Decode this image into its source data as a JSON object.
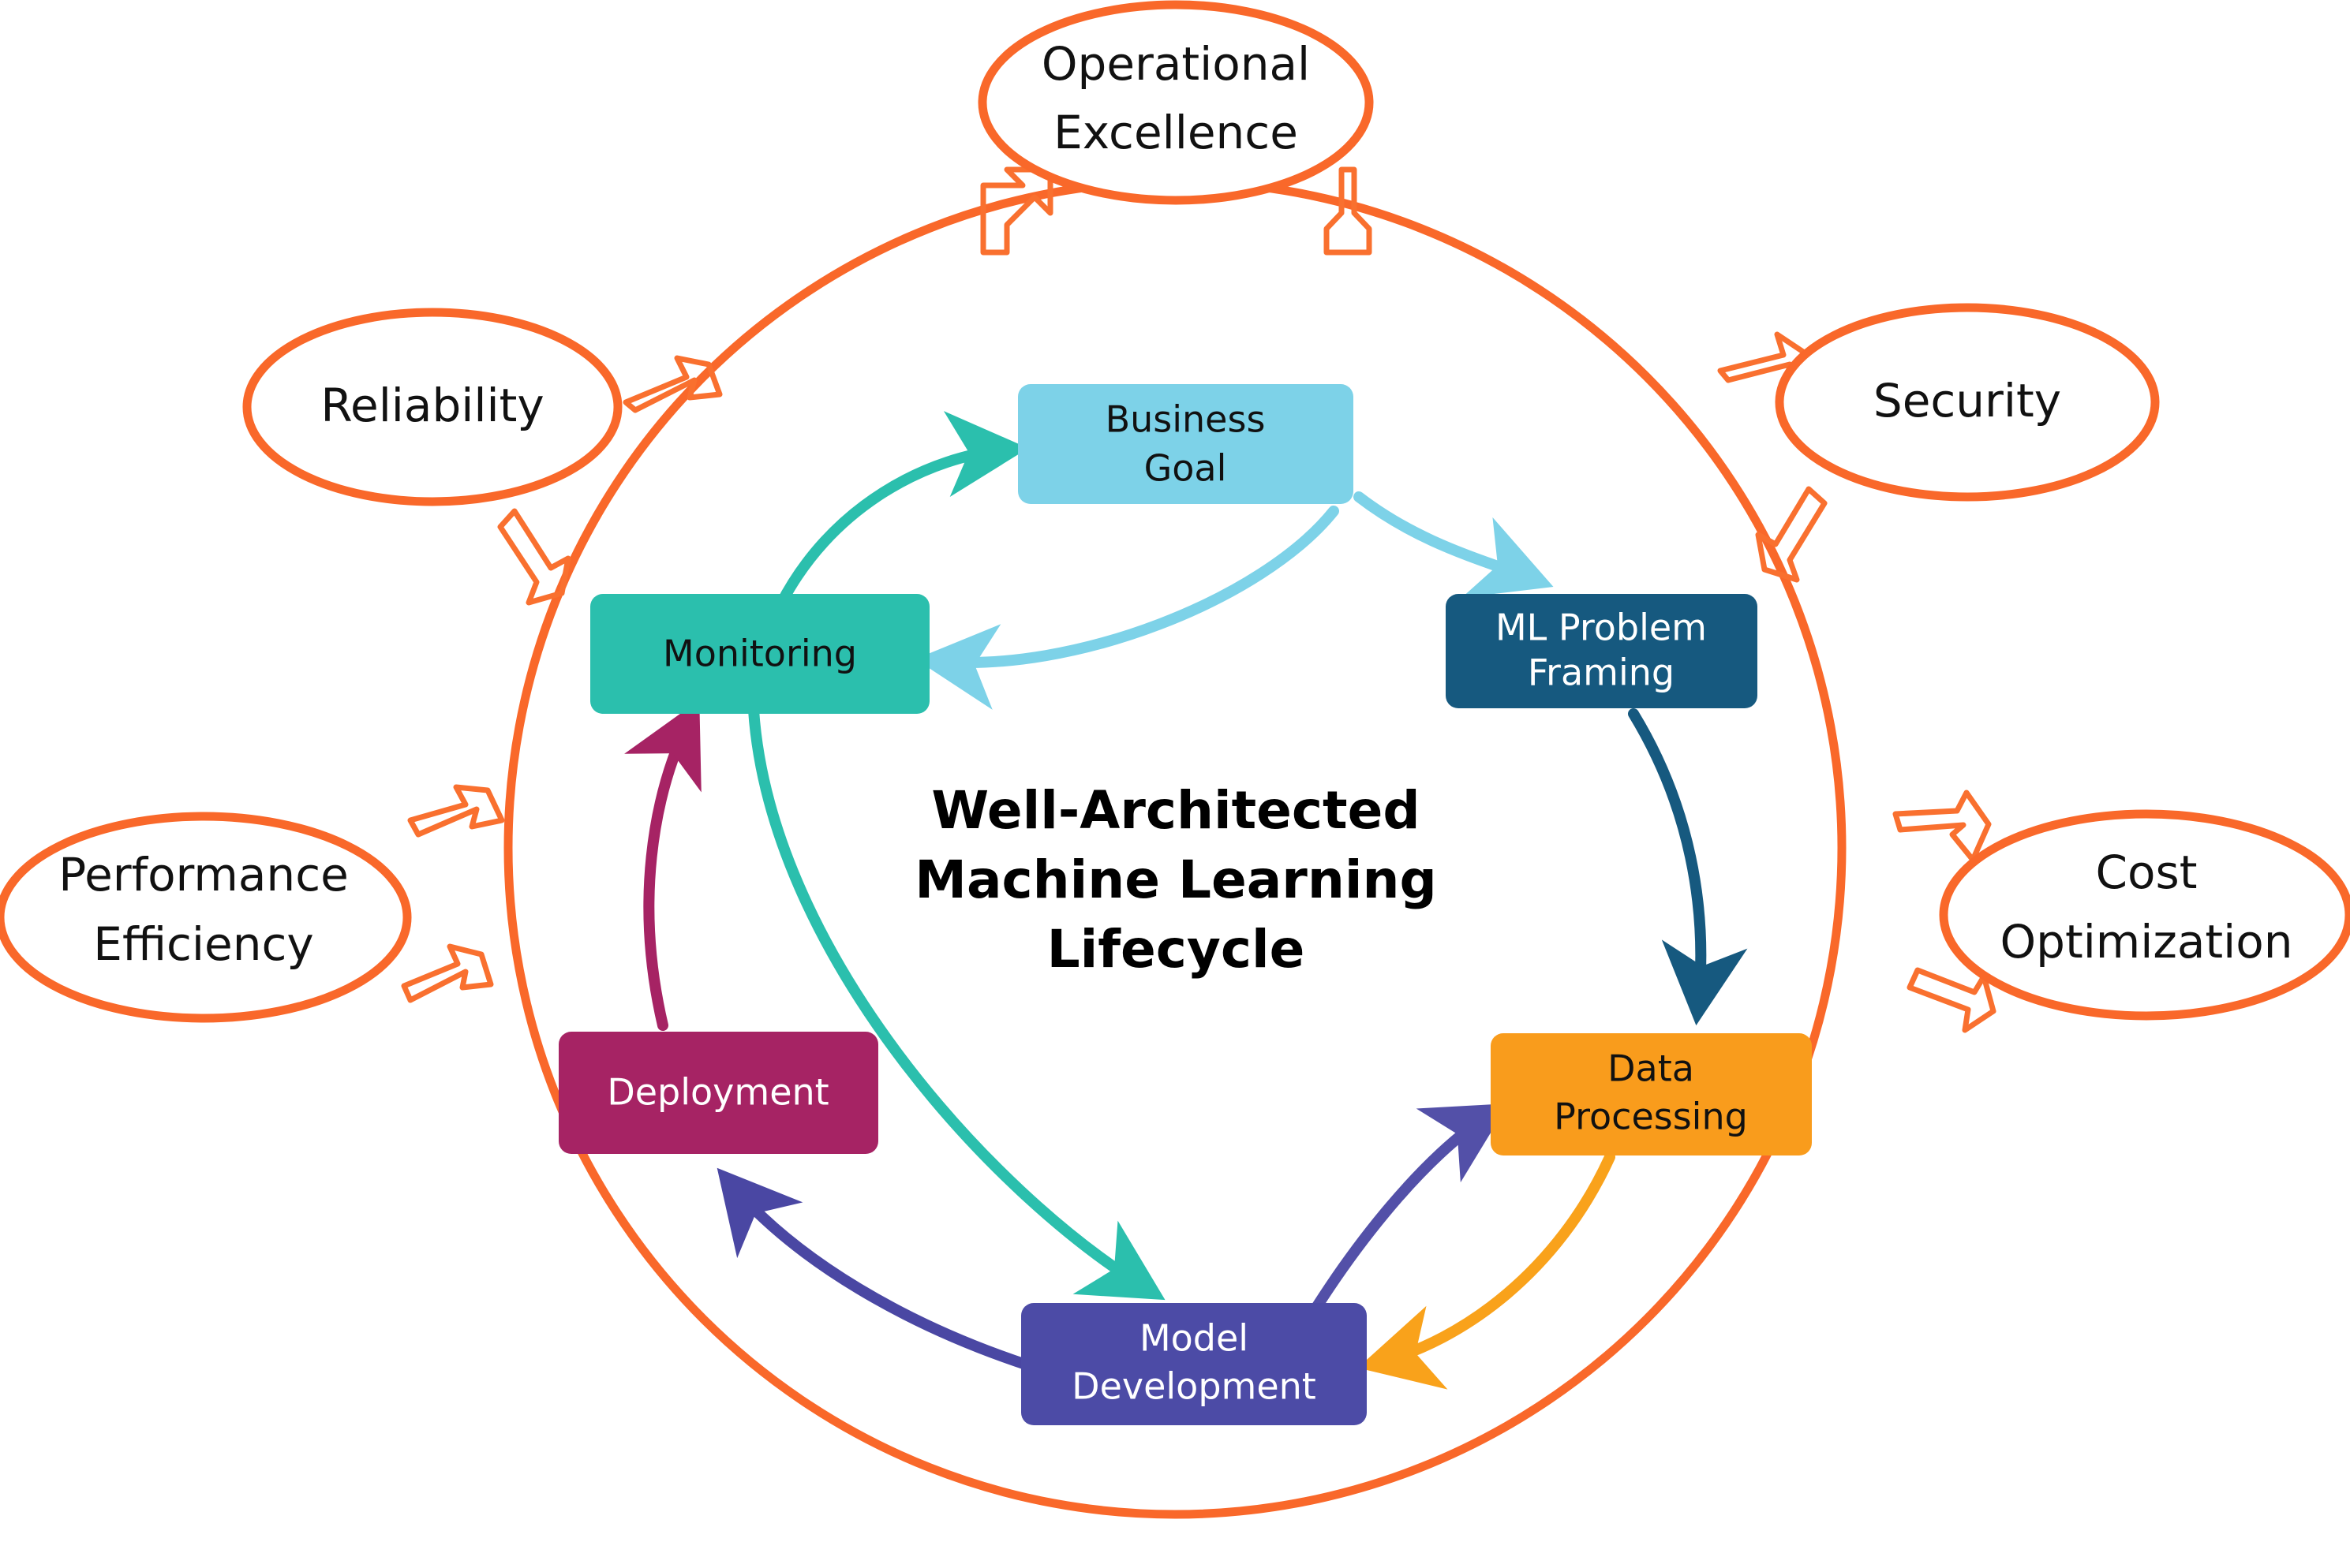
{
  "diagram": {
    "title": "Well-Architected Machine Learning Lifecycle",
    "title_lines": [
      "Well-Architected",
      "Machine Learning",
      "Lifecycle"
    ],
    "background_color": "#FFFFFF",
    "frame_color": "#F9682A"
  },
  "center": {
    "line1": "Well-Architected",
    "line2": "Machine Learning",
    "line3": "Lifecycle"
  },
  "lifecycle_nodes": [
    {
      "id": "business-goal",
      "label_lines": [
        "Business",
        "Goal"
      ],
      "line1": "Business",
      "line2": "Goal",
      "fill": "#7DD2E8",
      "text_color": "#111111"
    },
    {
      "id": "ml-problem-framing",
      "label_lines": [
        "ML Problem",
        "Framing"
      ],
      "line1": "ML Problem",
      "line2": "Framing",
      "fill": "#16597F",
      "text_color": "#FFFFFF"
    },
    {
      "id": "data-processing",
      "label_lines": [
        "Data",
        "Processing"
      ],
      "line1": "Data",
      "line2": "Processing",
      "fill": "#F99C1C",
      "text_color": "#111111"
    },
    {
      "id": "model-development",
      "label_lines": [
        "Model",
        "Development"
      ],
      "line1": "Model",
      "line2": "Development",
      "fill": "#4C4BA6",
      "text_color": "#FFFFFF"
    },
    {
      "id": "deployment",
      "label_lines": [
        "Deployment"
      ],
      "line1": "Deployment",
      "line2": "",
      "fill": "#A62364",
      "text_color": "#FFFFFF"
    },
    {
      "id": "monitoring",
      "label_lines": [
        "Monitoring"
      ],
      "line1": "Monitoring",
      "line2": "",
      "fill": "#2BBFAD",
      "text_color": "#111111"
    }
  ],
  "pillars": [
    {
      "id": "operational-excellence",
      "line1": "Operational",
      "line2": "Excellence",
      "position": "top"
    },
    {
      "id": "security",
      "line1": "Security",
      "line2": "",
      "position": "top-right"
    },
    {
      "id": "cost-optimization",
      "line1": "Cost",
      "line2": "Optimization",
      "position": "bottom-right"
    },
    {
      "id": "performance-efficiency",
      "line1": "Performance",
      "line2": "Efficiency",
      "position": "bottom-left"
    },
    {
      "id": "reliability",
      "line1": "Reliability",
      "line2": "",
      "position": "top-left"
    }
  ],
  "flows": [
    {
      "id": "business-goal-to-ml-problem-framing",
      "from": "Business Goal",
      "to": "ML Problem Framing",
      "color": "#7DD2E8"
    },
    {
      "id": "ml-problem-framing-to-data-processing",
      "from": "ML Problem Framing",
      "to": "Data Processing",
      "color": "#16597F"
    },
    {
      "id": "data-processing-to-model-development",
      "from": "Data Processing",
      "to": "Model Development",
      "color": "#F9A21B"
    },
    {
      "id": "model-development-to-data-processing",
      "from": "Model Development",
      "to": "Data Processing",
      "color": "#5350A8"
    },
    {
      "id": "model-development-to-deployment",
      "from": "Model Development",
      "to": "Deployment",
      "color": "#4A47A3"
    },
    {
      "id": "deployment-to-monitoring",
      "from": "Deployment",
      "to": "Monitoring",
      "color": "#A62364"
    },
    {
      "id": "monitoring-to-business-goal",
      "from": "Monitoring",
      "to": "Business Goal",
      "color": "#2BBFAD"
    },
    {
      "id": "business-goal-to-monitoring",
      "from": "Business Goal",
      "to": "Monitoring",
      "color": "#7DD2E8"
    },
    {
      "id": "monitoring-to-model-development",
      "from": "Monitoring",
      "to": "Model Development",
      "color": "#2BBFAD"
    }
  ]
}
